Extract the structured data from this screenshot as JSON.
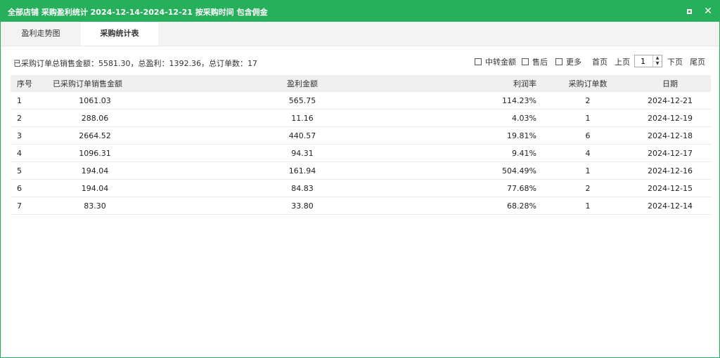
{
  "window": {
    "title": "全部店铺 采购盈利统计 2024-12-14-2024-12-21 按采购时间 包含佣金"
  },
  "tabs": [
    {
      "label": "盈利走势图"
    },
    {
      "label": "采购统计表"
    }
  ],
  "summary": "已采购订单总销售金额：5581.30，总盈利：1392.36，总订单数：17",
  "controls": {
    "transfer_amount": "中转金额",
    "after_sale": "售后",
    "more": "更多",
    "first_page": "首页",
    "prev_page": "上页",
    "page_value": "1",
    "next_page": "下页",
    "last_page": "尾页"
  },
  "table": {
    "headers": [
      "序号",
      "已采购订单销售金额",
      "盈利金额",
      "利润率",
      "采购订单数",
      "日期"
    ],
    "rows": [
      [
        "1",
        "1061.03",
        "565.75",
        "114.23%",
        "2",
        "2024-12-21"
      ],
      [
        "2",
        "288.06",
        "11.16",
        "4.03%",
        "1",
        "2024-12-19"
      ],
      [
        "3",
        "2664.52",
        "440.57",
        "19.81%",
        "6",
        "2024-12-18"
      ],
      [
        "4",
        "1096.31",
        "94.31",
        "9.41%",
        "4",
        "2024-12-17"
      ],
      [
        "5",
        "194.04",
        "161.94",
        "504.49%",
        "1",
        "2024-12-16"
      ],
      [
        "6",
        "194.04",
        "84.83",
        "77.68%",
        "2",
        "2024-12-15"
      ],
      [
        "7",
        "83.30",
        "33.80",
        "68.28%",
        "1",
        "2024-12-14"
      ]
    ]
  },
  "colors": {
    "accent": "#27b05c"
  }
}
